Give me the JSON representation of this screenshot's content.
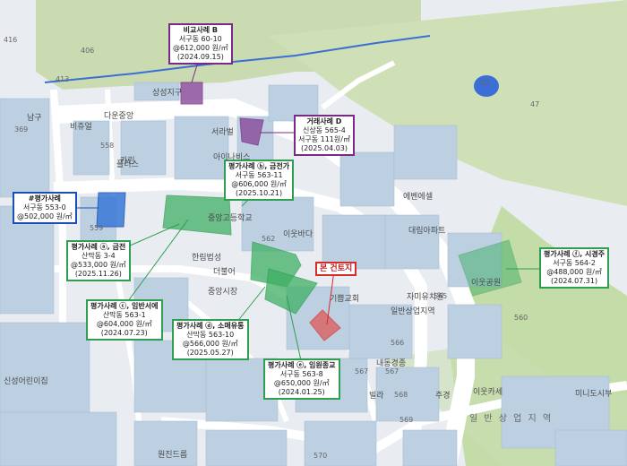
{
  "colors": {
    "background": "#e9edf2",
    "green_area": "#c8dcb0",
    "building": "#bcd0e2",
    "road": "#ffffff",
    "water": "#3b6fd6",
    "comp_green": "#2e9e50",
    "comp_purple": "#7a2a86",
    "comp_blue": "#1a4fb8",
    "subject_red": "#d42b2b"
  },
  "callouts": [
    {
      "id": "c1",
      "color": "purple",
      "lines": [
        "비교사례 B",
        "서구동 60-10",
        "@612,000 원/㎡",
        "(2024.09.15)"
      ]
    },
    {
      "id": "c2",
      "color": "purple",
      "lines": [
        "거래사례 D",
        "신상동 565-4",
        "서구동 111원/㎡",
        "(2025.04.03)"
      ]
    },
    {
      "id": "c3",
      "color": "blue",
      "lines": [
        "#평가사례",
        "서구동 553-0",
        "@502,000 원/㎡"
      ]
    },
    {
      "id": "c4",
      "color": "green",
      "lines": [
        "평가사례 ⓑ, 금전가",
        "서구동 563-11",
        "@606,000 원/㎡",
        "(2025.10.21)"
      ]
    },
    {
      "id": "c5",
      "color": "green",
      "lines": [
        "평가사례 ⓐ, 금전",
        "산막동 3-4",
        "@533,000 원/㎡",
        "(2025.11.26)"
      ]
    },
    {
      "id": "c6",
      "color": "green",
      "lines": [
        "평가사례 ⓒ, 임반서에",
        "산막동 563-1",
        "@604,000 원/㎡",
        "(2024.07.23)"
      ]
    },
    {
      "id": "c7",
      "color": "green",
      "lines": [
        "평가사례 ⓓ, 소매유통",
        "산막동 563-10",
        "@566,000 원/㎡",
        "(2025.05.27)"
      ]
    },
    {
      "id": "c8",
      "color": "green",
      "lines": [
        "평가사례 ⓔ, 임원종교",
        "서구동 563-8",
        "@650,000 원/㎡",
        "(2024.01.25)"
      ]
    },
    {
      "id": "c9",
      "color": "green",
      "lines": [
        "평가사례 ⓕ, 시경주",
        "서구동 564-2",
        "@488,000 원/㎡",
        "(2024.07.31)"
      ]
    },
    {
      "id": "c10",
      "color": "red",
      "lines": [
        "본 건토지"
      ]
    }
  ],
  "lot_labels": [
    "416",
    "406",
    "413",
    "369",
    "558",
    "559",
    "562",
    "565",
    "567",
    "566",
    "560",
    "567",
    "568",
    "569",
    "570",
    "42",
    "47"
  ],
  "place_labels": [
    "다운중앙",
    "비쥬얼",
    "서라벌",
    "아이나비스",
    "플러스",
    "대림아파트",
    "이웃바다",
    "중앙고등학교",
    "에벤에셀",
    "한림법성",
    "더불어",
    "기쁨교회",
    "중앙시장",
    "상성지구",
    "자미유치원",
    "이웃카세",
    "일반상업지역",
    "신성어린이집",
    "빌라",
    "주경",
    "카린",
    "내동경종",
    "미니도시부",
    "이웃공원",
    "남구",
    "원진드름"
  ],
  "roads": [
    "원진드름",
    "일 반 상 업 지 역"
  ]
}
